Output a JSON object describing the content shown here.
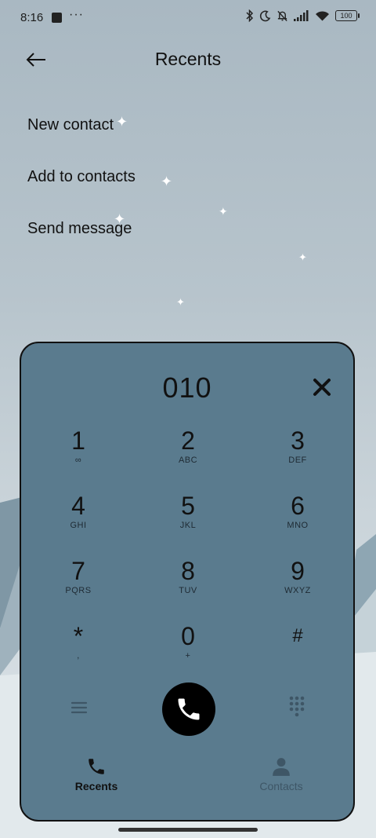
{
  "status_bar": {
    "time": "8:16",
    "more": "···",
    "battery": "100",
    "icons": [
      "bluetooth-icon",
      "moon-icon",
      "bell-off-icon",
      "signal-icon",
      "wifi-icon",
      "battery-icon"
    ]
  },
  "header": {
    "title": "Recents",
    "back_icon": "arrow-left-icon"
  },
  "menu": {
    "items": [
      "New contact",
      "Add to contacts",
      "Send message"
    ]
  },
  "dialer": {
    "number": "010",
    "clear_icon": "close-icon",
    "keys": [
      {
        "digit": "1",
        "letters": "∞"
      },
      {
        "digit": "2",
        "letters": "ABC"
      },
      {
        "digit": "3",
        "letters": "DEF"
      },
      {
        "digit": "4",
        "letters": "GHI"
      },
      {
        "digit": "5",
        "letters": "JKL"
      },
      {
        "digit": "6",
        "letters": "MNO"
      },
      {
        "digit": "7",
        "letters": "PQRS"
      },
      {
        "digit": "8",
        "letters": "TUV"
      },
      {
        "digit": "9",
        "letters": "WXYZ"
      },
      {
        "digit": "*",
        "letters": ","
      },
      {
        "digit": "0",
        "letters": "+"
      },
      {
        "digit": "#",
        "letters": ""
      }
    ],
    "call_icon": "phone-icon"
  },
  "tabs": {
    "recents": "Recents",
    "contacts": "Contacts",
    "active": "Recents"
  },
  "colors": {
    "dialer_bg": "#5a7b8e",
    "call_button": "#000000",
    "inactive_tab": "#3e5666"
  }
}
